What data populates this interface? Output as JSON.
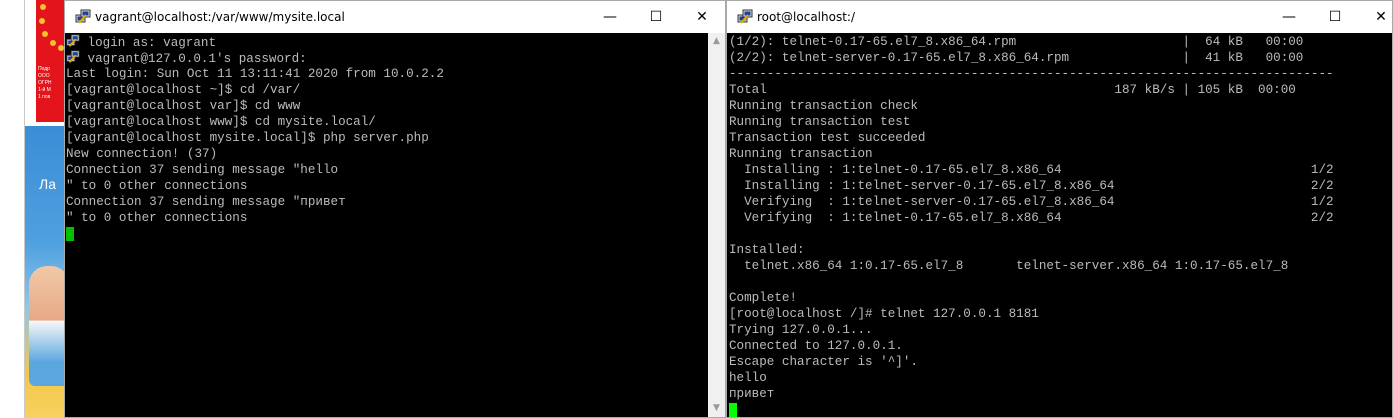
{
  "background": {
    "red_ad_lines": [
      "Подр",
      "ООО",
      "ОГРН",
      "1-й М",
      "1 пов"
    ],
    "banner_text": "Ла"
  },
  "windows": {
    "left": {
      "title": "vagrant@localhost:/var/www/mysite.local",
      "icon": "putty-icon",
      "minimize": "—",
      "maximize": "☐",
      "close": "✕",
      "cursor_color": "#00c000",
      "lines": [
        {
          "icon": "putty-icon",
          "text": " login as: vagrant"
        },
        {
          "icon": "putty-icon",
          "text": " vagrant@127.0.0.1's password:"
        },
        {
          "text": "Last login: Sun Oct 11 13:11:41 2020 from 10.0.2.2"
        },
        {
          "text": "[vagrant@localhost ~]$ cd /var/"
        },
        {
          "text": "[vagrant@localhost var]$ cd www"
        },
        {
          "text": "[vagrant@localhost www]$ cd mysite.local/"
        },
        {
          "text": "[vagrant@localhost mysite.local]$ php server.php"
        },
        {
          "text": "New connection! (37)"
        },
        {
          "text": "Connection 37 sending message \"hello"
        },
        {
          "text": "\" to 0 other connections"
        },
        {
          "text": "Connection 37 sending message \"привет"
        },
        {
          "text": "\" to 0 other connections"
        },
        {
          "cursor": true,
          "text": ""
        }
      ]
    },
    "right": {
      "title": "root@localhost:/",
      "icon": "putty-icon",
      "minimize": "—",
      "maximize": "☐",
      "close": "✕",
      "cursor_color": "#00ff00",
      "lines": [
        {
          "text": "(1/2): telnet-0.17-65.el7_8.x86_64.rpm                      |  64 kB   00:00"
        },
        {
          "text": "(2/2): telnet-server-0.17-65.el7_8.x86_64.rpm               |  41 kB   00:00"
        },
        {
          "text": "--------------------------------------------------------------------------------"
        },
        {
          "text": "Total                                              187 kB/s | 105 kB  00:00"
        },
        {
          "text": "Running transaction check"
        },
        {
          "text": "Running transaction test"
        },
        {
          "text": "Transaction test succeeded"
        },
        {
          "text": "Running transaction"
        },
        {
          "text": "  Installing : 1:telnet-0.17-65.el7_8.x86_64                                 1/2"
        },
        {
          "text": "  Installing : 1:telnet-server-0.17-65.el7_8.x86_64                          2/2"
        },
        {
          "text": "  Verifying  : 1:telnet-server-0.17-65.el7_8.x86_64                          1/2"
        },
        {
          "text": "  Verifying  : 1:telnet-0.17-65.el7_8.x86_64                                 2/2"
        },
        {
          "text": ""
        },
        {
          "text": "Installed:"
        },
        {
          "text": "  telnet.x86_64 1:0.17-65.el7_8       telnet-server.x86_64 1:0.17-65.el7_8"
        },
        {
          "text": ""
        },
        {
          "text": "Complete!"
        },
        {
          "text": "[root@localhost /]# telnet 127.0.0.1 8181"
        },
        {
          "text": "Trying 127.0.0.1..."
        },
        {
          "text": "Connected to 127.0.0.1."
        },
        {
          "text": "Escape character is '^]'."
        },
        {
          "text": "hello"
        },
        {
          "text": "привет"
        },
        {
          "cursor": true,
          "text": ""
        }
      ]
    }
  }
}
